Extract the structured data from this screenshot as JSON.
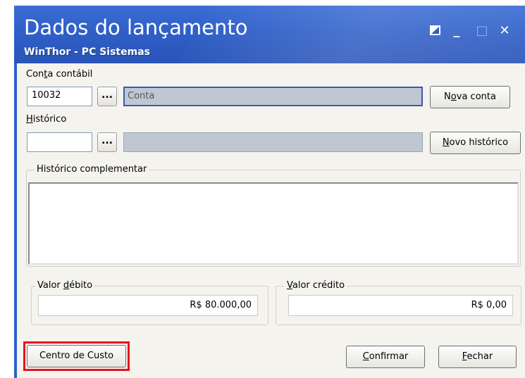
{
  "window": {
    "title": "Dados do lançamento",
    "subtitle": "WinThor - PC Sistemas",
    "controls": {
      "restore_icon": "restore-icon",
      "minimize_symbol": "_",
      "maximize_symbol": "□",
      "close_symbol": "✕"
    }
  },
  "conta_contabil": {
    "label_pre": "Con",
    "label_u": "t",
    "label_post": "a contábil",
    "code_value": "10032",
    "lookup_label": "...",
    "description_value": "Conta",
    "new_button_pre": "N",
    "new_button_u": "o",
    "new_button_post": "va conta"
  },
  "historico": {
    "label_u": "H",
    "label_post": "istórico",
    "code_value": "",
    "lookup_label": "...",
    "description_value": "",
    "new_button_u": "N",
    "new_button_post": "ovo histórico"
  },
  "historico_complementar": {
    "label": "Histórico complementar",
    "value": ""
  },
  "valor_debito": {
    "label_pre": "Valor ",
    "label_u": "d",
    "label_post": "ébito",
    "value": "R$ 80.000,00"
  },
  "valor_credito": {
    "label_u": "V",
    "label_post": "alor crédito",
    "value": "R$ 0,00"
  },
  "buttons": {
    "centro_custo": "Centro de Custo",
    "confirmar_u": "C",
    "confirmar_post": "onfirmar",
    "fechar_u": "F",
    "fechar_post": "echar"
  },
  "colors": {
    "title_bar": "#2f5fc8",
    "highlight": "#e8121c",
    "client_bg": "#f4f3ee"
  }
}
